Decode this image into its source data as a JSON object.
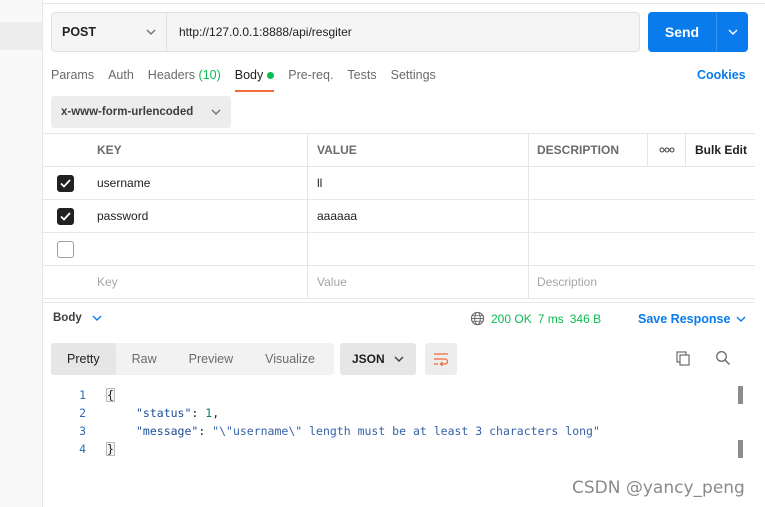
{
  "request": {
    "method": "POST",
    "url": "http://127.0.0.1:8888/api/resgiter",
    "send_label": "Send"
  },
  "tabs": [
    {
      "label": "Params"
    },
    {
      "label": "Auth"
    },
    {
      "label": "Headers",
      "count": "(10)"
    },
    {
      "label": "Body"
    },
    {
      "label": "Pre-req."
    },
    {
      "label": "Tests"
    },
    {
      "label": "Settings"
    }
  ],
  "cookies_label": "Cookies",
  "body_type": "x-www-form-urlencoded",
  "table": {
    "headers": {
      "key": "KEY",
      "value": "VALUE",
      "description": "DESCRIPTION",
      "more": "ooo",
      "bulk": "Bulk Edit"
    },
    "rows": [
      {
        "checked": true,
        "key": "username",
        "value": "ll",
        "description": ""
      },
      {
        "checked": true,
        "key": "password",
        "value": "aaaaaa",
        "description": ""
      },
      {
        "checked": false,
        "key": "",
        "value": "",
        "description": ""
      }
    ],
    "placeholders": {
      "key": "Key",
      "value": "Value",
      "description": "Description"
    }
  },
  "response": {
    "section_label": "Body",
    "status": "200 OK",
    "time": "7 ms",
    "size": "346 B",
    "save_label": "Save Response",
    "view_tabs": [
      "Pretty",
      "Raw",
      "Preview",
      "Visualize"
    ],
    "format": "JSON",
    "code_lines": [
      {
        "n": "1",
        "text": "{"
      },
      {
        "n": "2",
        "key": "\"status\"",
        "sep": ": ",
        "val": "1",
        "end": ","
      },
      {
        "n": "3",
        "key": "\"message\"",
        "sep": ": ",
        "val": "\"\\\"username\\\" length must be at least 3 characters long\"",
        "end": ""
      },
      {
        "n": "4",
        "text": "}"
      }
    ]
  },
  "watermark": "CSDN @yancy_peng",
  "colors": {
    "accent": "#097bed",
    "active_tab": "#f26b3a",
    "success": "#0cbb52"
  }
}
